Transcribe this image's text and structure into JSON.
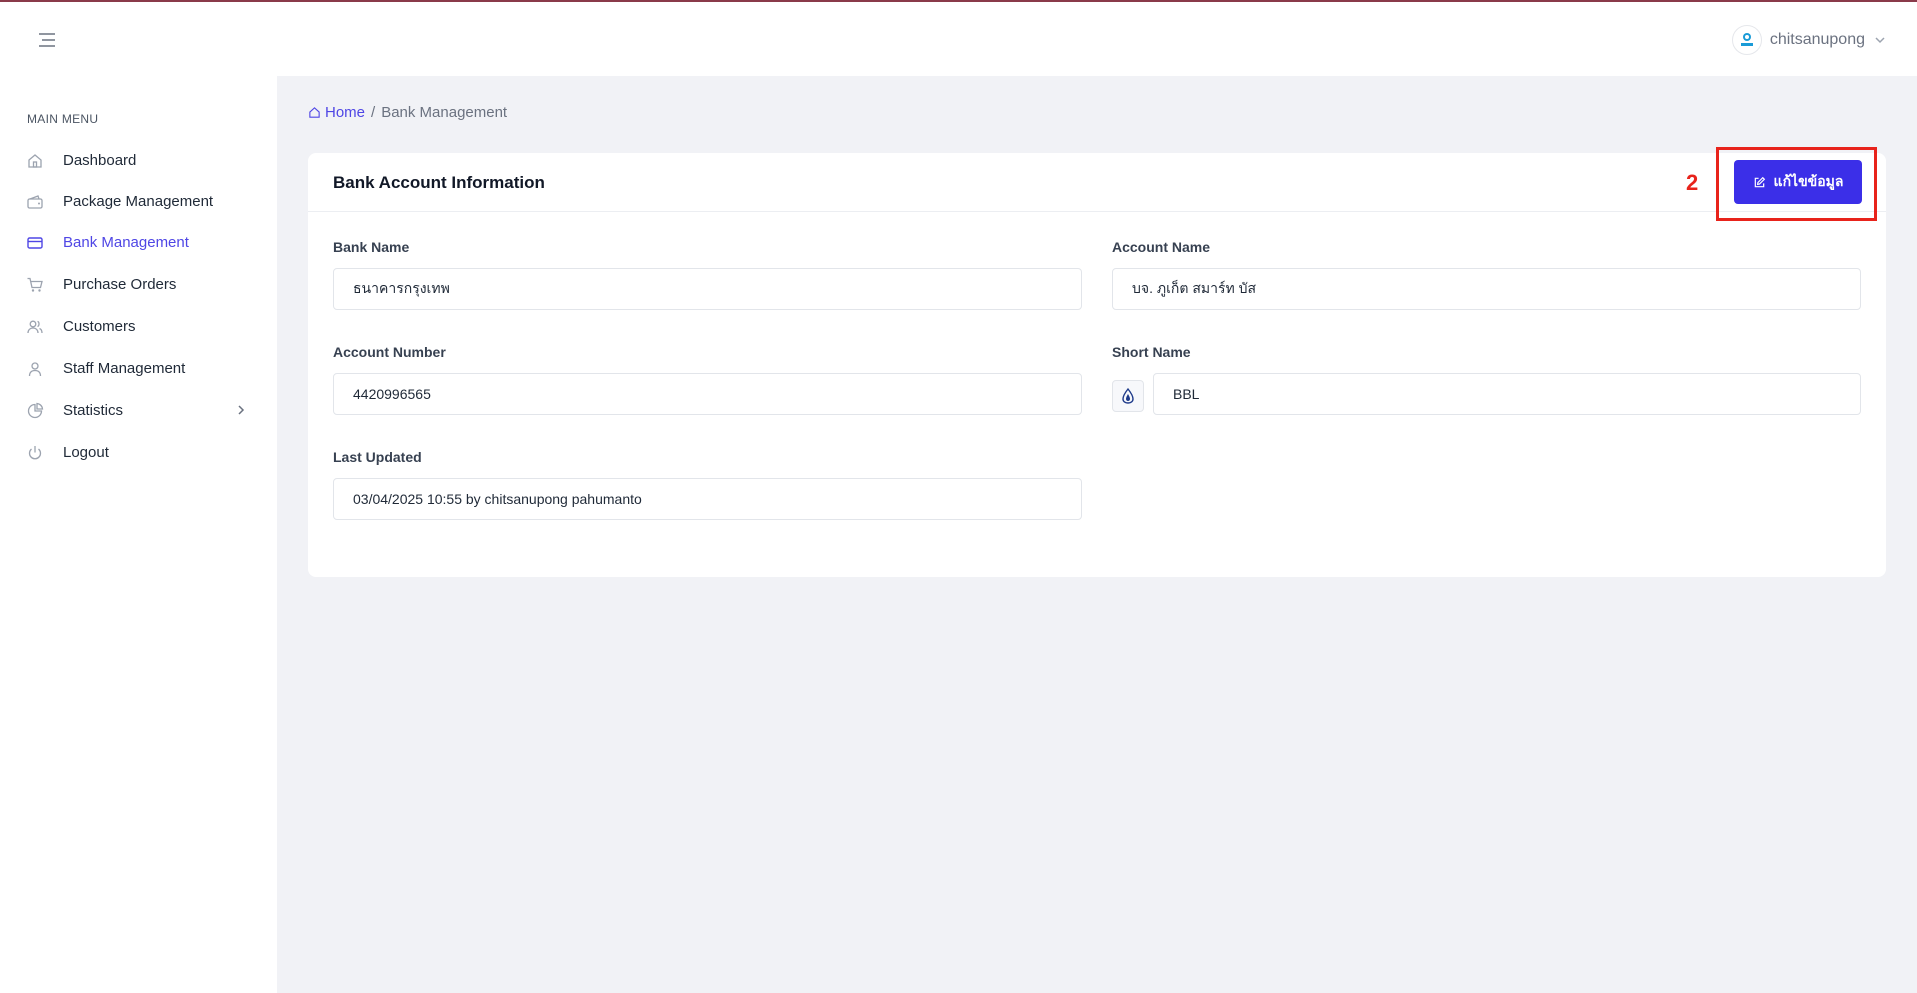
{
  "header": {
    "username": "chitsanupong"
  },
  "sidebar": {
    "heading": "MAIN MENU",
    "items": [
      {
        "label": "Dashboard"
      },
      {
        "label": "Package Management"
      },
      {
        "label": "Bank Management"
      },
      {
        "label": "Purchase Orders"
      },
      {
        "label": "Customers"
      },
      {
        "label": "Staff Management"
      },
      {
        "label": "Statistics"
      },
      {
        "label": "Logout"
      }
    ],
    "active_item": "Bank Management"
  },
  "breadcrumb": {
    "home": "Home",
    "separator": "/",
    "current": "Bank Management"
  },
  "card": {
    "title": "Bank Account Information",
    "edit_button": "แก้ไขข้อมูล",
    "annotation_number": "2",
    "fields": {
      "bank_name": {
        "label": "Bank Name",
        "value": "ธนาคารกรุงเทพ"
      },
      "account_name": {
        "label": "Account Name",
        "value": "บจ. ภูเก็ต สมาร์ท บัส"
      },
      "account_number": {
        "label": "Account Number",
        "value": "4420996565"
      },
      "short_name": {
        "label": "Short Name",
        "value": "BBL"
      },
      "last_updated": {
        "label": "Last Updated",
        "value": "03/04/2025 10:55 by chitsanupong pahumanto"
      }
    }
  },
  "colors": {
    "accent": "#4f46e5",
    "button": "#3b2fe8",
    "annotation": "#e8231b",
    "background": "#f1f2f6"
  }
}
